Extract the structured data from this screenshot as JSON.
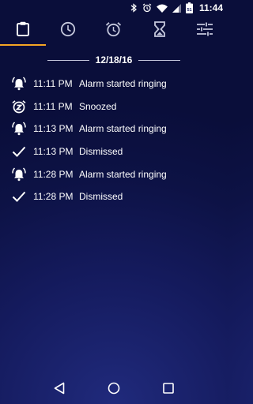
{
  "status_bar": {
    "icons": [
      "bluetooth-icon",
      "alarm-icon",
      "wifi-icon",
      "signal-icon",
      "battery-icon"
    ],
    "battery_level": "51",
    "time": "11:44"
  },
  "tabs": [
    {
      "name": "history",
      "icon": "clipboard-icon",
      "active": true
    },
    {
      "name": "clock",
      "icon": "clock-icon",
      "active": false
    },
    {
      "name": "alarms",
      "icon": "alarm-clock-icon",
      "active": false
    },
    {
      "name": "timer",
      "icon": "hourglass-icon",
      "active": false
    },
    {
      "name": "settings",
      "icon": "sliders-icon",
      "active": false
    }
  ],
  "accent_color": "#f5a623",
  "history": {
    "date": "12/18/16",
    "events": [
      {
        "icon": "alarm-ringing-icon",
        "time": "11:11 PM",
        "text": "Alarm started ringing"
      },
      {
        "icon": "snooze-icon",
        "time": "11:11 PM",
        "text": "Snoozed"
      },
      {
        "icon": "alarm-ringing-icon",
        "time": "11:13 PM",
        "text": "Alarm started ringing"
      },
      {
        "icon": "checkmark-icon",
        "time": "11:13 PM",
        "text": "Dismissed"
      },
      {
        "icon": "alarm-ringing-icon",
        "time": "11:28 PM",
        "text": "Alarm started ringing"
      },
      {
        "icon": "checkmark-icon",
        "time": "11:28 PM",
        "text": "Dismissed"
      }
    ]
  },
  "nav_bar": {
    "buttons": [
      "back-icon",
      "home-icon",
      "recents-icon"
    ]
  }
}
